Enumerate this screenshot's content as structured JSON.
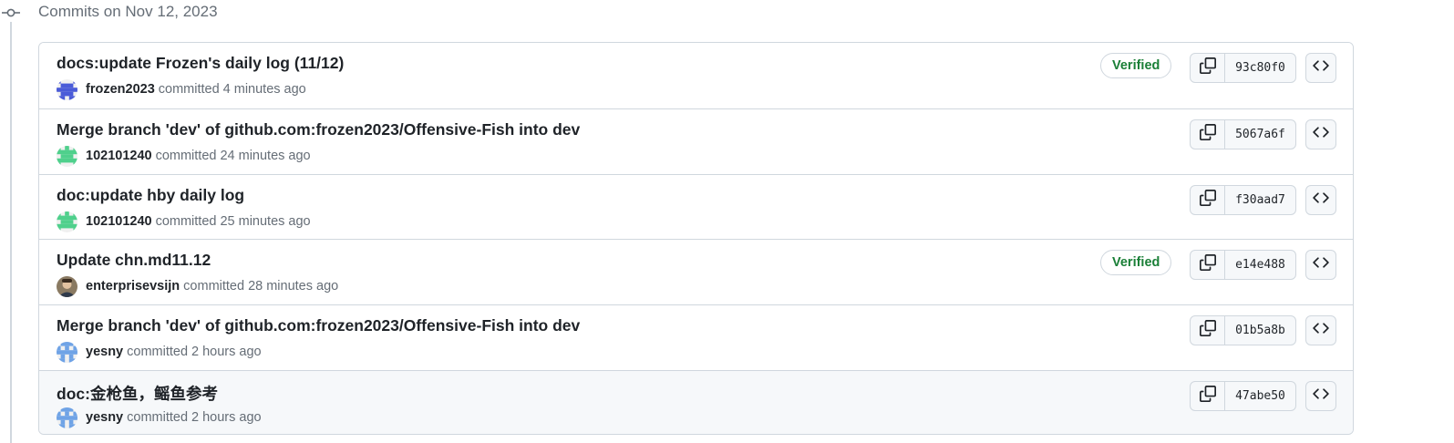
{
  "group": {
    "header": "Commits on Nov 12, 2023"
  },
  "verb": "committed",
  "verified_label": "Verified",
  "colors": {
    "verified": "#1a7f37",
    "border": "#d0d7de",
    "muted": "#656d76"
  },
  "commits": [
    {
      "title": "docs:update Frozen's daily log (11/12)",
      "author": "frozen2023",
      "time": "4 minutes ago",
      "verified": true,
      "sha": "93c80f0",
      "avatar": "identicon-blue"
    },
    {
      "title": "Merge branch 'dev' of github.com:frozen2023/Offensive-Fish into dev",
      "author": "102101240",
      "time": "24 minutes ago",
      "verified": false,
      "sha": "5067a6f",
      "avatar": "identicon-green"
    },
    {
      "title": "doc:update hby daily log",
      "author": "102101240",
      "time": "25 minutes ago",
      "verified": false,
      "sha": "f30aad7",
      "avatar": "identicon-green"
    },
    {
      "title": "Update chn.md11.12",
      "author": "enterprisevsijn",
      "time": "28 minutes ago",
      "verified": true,
      "sha": "e14e488",
      "avatar": "photo-avatar"
    },
    {
      "title": "Merge branch 'dev' of github.com:frozen2023/Offensive-Fish into dev",
      "author": "yesny",
      "time": "2 hours ago",
      "verified": false,
      "sha": "01b5a8b",
      "avatar": "identicon-lightblue"
    },
    {
      "title": "doc:金枪鱼，鳐鱼参考",
      "author": "yesny",
      "time": "2 hours ago",
      "verified": false,
      "sha": "47abe50",
      "avatar": "identicon-lightblue"
    }
  ]
}
